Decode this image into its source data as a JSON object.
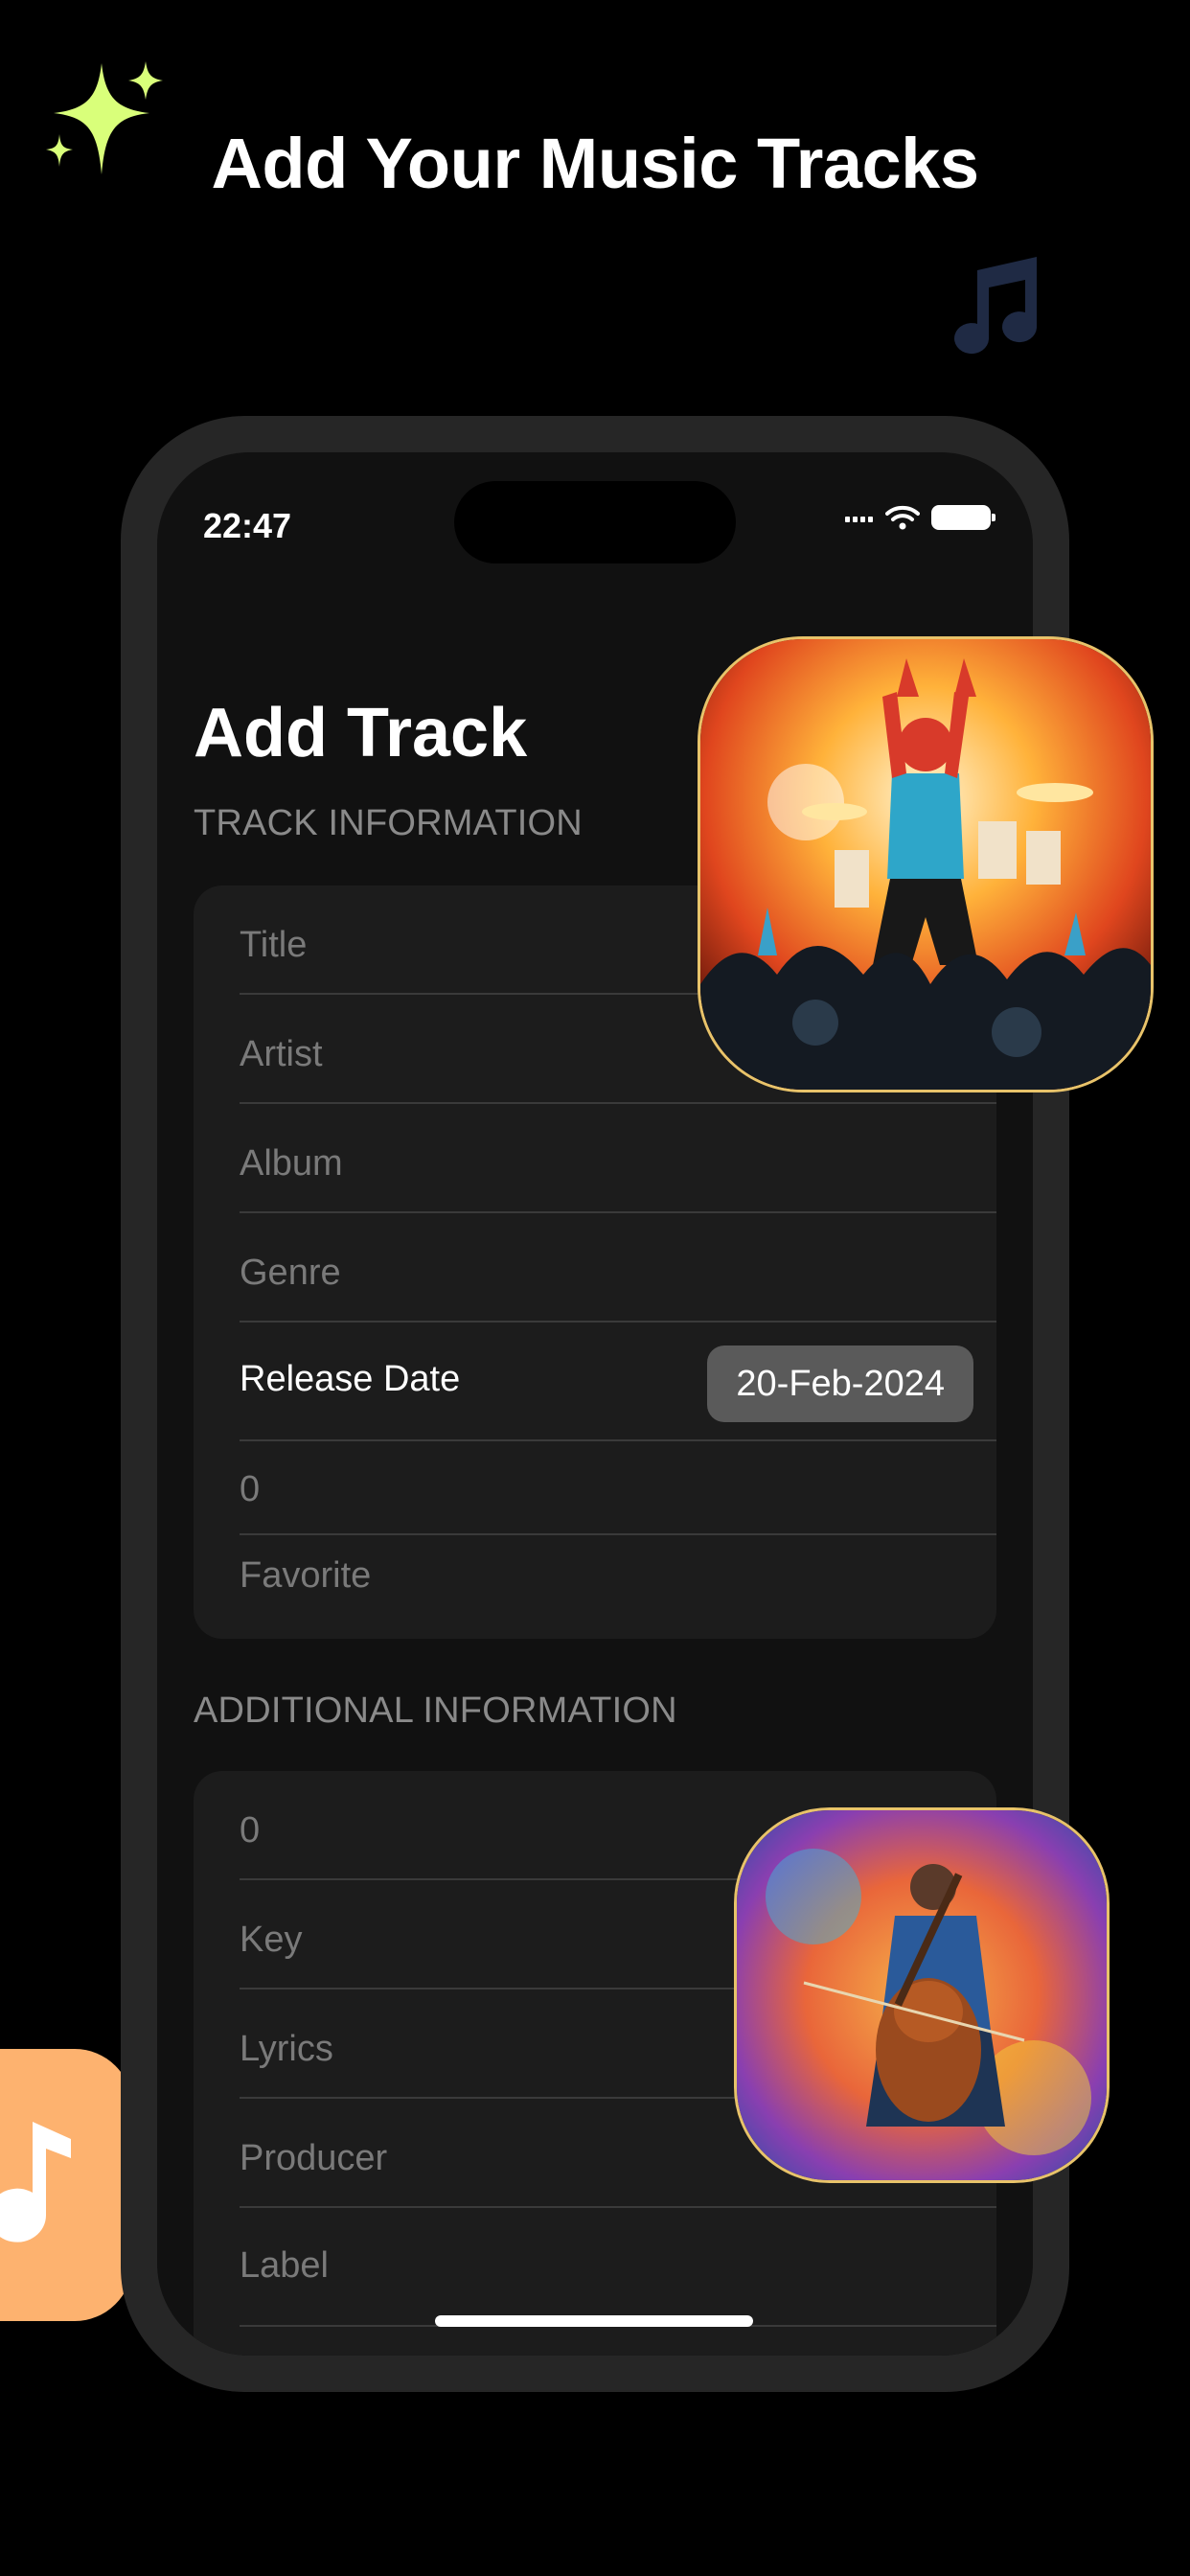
{
  "headline": "Add Your Music Tracks",
  "colors": {
    "sparkle": "#d9ff7a",
    "note_deco": "#1f2a44",
    "side_tile": "#fdb26f",
    "art_border": "#e8c36a"
  },
  "icons": {
    "sparkle": "sparkle-icon",
    "note": "music-note-icon"
  },
  "status": {
    "time": "22:47"
  },
  "screen": {
    "title": "Add Track",
    "track_section": {
      "header": "TRACK INFORMATION",
      "fields": {
        "title": "Title",
        "artist": "Artist",
        "album": "Album",
        "genre": "Genre",
        "release_label": "Release Date",
        "release_value": "20-Feb-2024",
        "number": "0",
        "favorite": "Favorite"
      }
    },
    "additional_section": {
      "header": "ADDITIONAL INFORMATION",
      "fields": {
        "number": "0",
        "key": "Key",
        "lyrics": "Lyrics",
        "producer": "Producer",
        "label": "Label"
      }
    }
  }
}
